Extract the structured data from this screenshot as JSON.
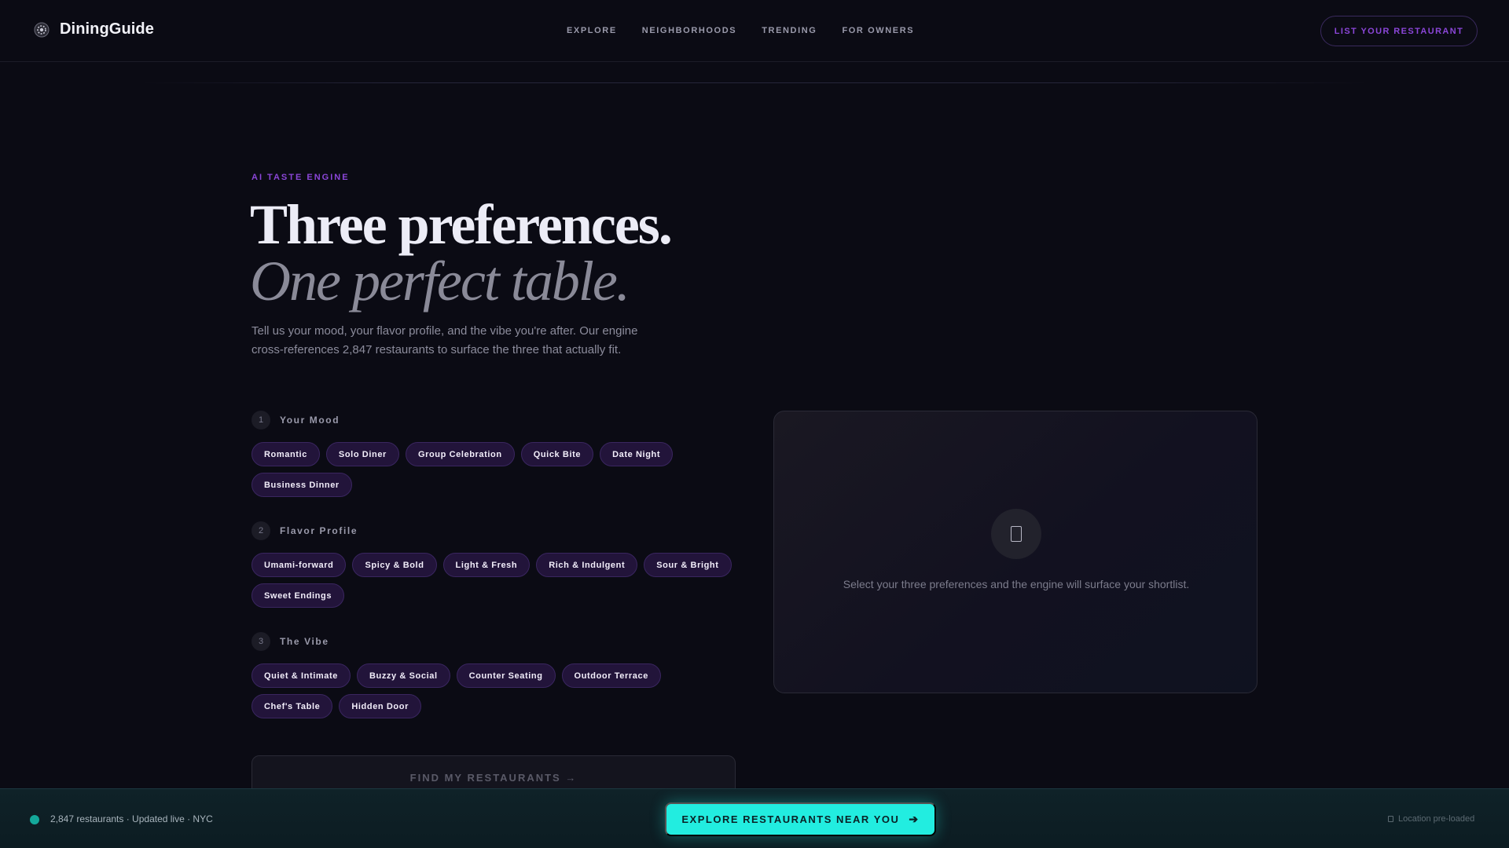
{
  "nav": {
    "brand": "DiningGuide",
    "links": [
      "EXPLORE",
      "NEIGHBORHOODS",
      "TRENDING",
      "FOR OWNERS"
    ],
    "cta": "LIST YOUR RESTAURANT"
  },
  "hero": {
    "eyebrow": "AI TASTE ENGINE",
    "title_line1": "Three preferences.",
    "title_line2": "One perfect table.",
    "lede": "Tell us your mood, your flavor profile, and the vibe you're after. Our engine cross-references 2,847 restaurants to surface the three that actually fit."
  },
  "groups": [
    {
      "num": "1",
      "title": "Your Mood",
      "options": [
        "Romantic",
        "Solo Diner",
        "Group Celebration",
        "Quick Bite",
        "Date Night",
        "Business Dinner"
      ]
    },
    {
      "num": "2",
      "title": "Flavor Profile",
      "options": [
        "Umami-forward",
        "Spicy & Bold",
        "Light & Fresh",
        "Rich & Indulgent",
        "Sour & Bright",
        "Sweet Endings"
      ]
    },
    {
      "num": "3",
      "title": "The Vibe",
      "options": [
        "Quiet & Intimate",
        "Buzzy & Social",
        "Counter Seating",
        "Outdoor Terrace",
        "Chef's Table",
        "Hidden Door"
      ]
    }
  ],
  "panel": {
    "icon": "bookmark-icon",
    "message": "Select your three preferences and the engine will surface your shortlist."
  },
  "find_button": "FIND MY RESTAURANTS →",
  "bottom_bar": {
    "status": "2,847 restaurants · Updated live · NYC",
    "cta": "EXPLORE RESTAURANTS NEAR YOU",
    "location": "Location pre-loaded"
  },
  "colors": {
    "accent_purple": "#8b46d8",
    "accent_teal": "#22ede0",
    "background": "#0b0b14"
  }
}
